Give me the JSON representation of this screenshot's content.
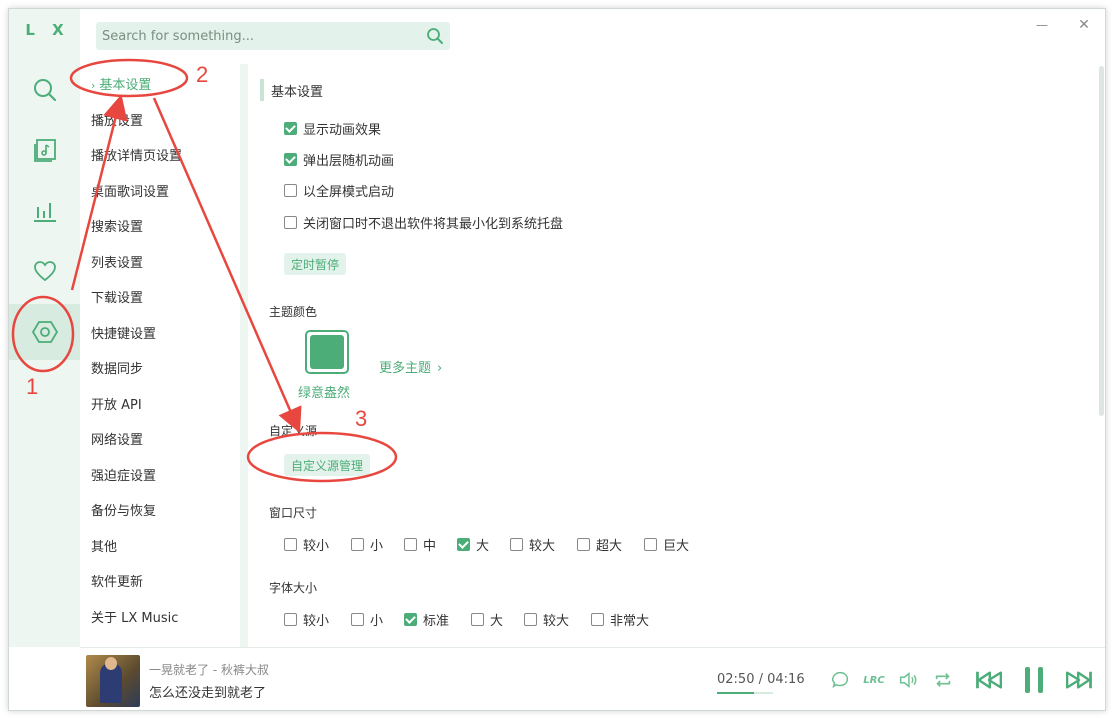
{
  "app": {
    "logo": "L X"
  },
  "search": {
    "placeholder": "Search for something..."
  },
  "window_controls": {
    "minimize": "—",
    "close": "✕"
  },
  "rail": [
    "search-icon",
    "song-list-icon",
    "leaderboard-icon",
    "heart-icon",
    "settings-icon"
  ],
  "sidenav": {
    "items": [
      {
        "label": "基本设置",
        "active": true
      },
      {
        "label": "播放设置"
      },
      {
        "label": "播放详情页设置"
      },
      {
        "label": "桌面歌词设置"
      },
      {
        "label": "搜索设置"
      },
      {
        "label": "列表设置"
      },
      {
        "label": "下载设置"
      },
      {
        "label": "快捷键设置"
      },
      {
        "label": "数据同步"
      },
      {
        "label": "开放 API"
      },
      {
        "label": "网络设置"
      },
      {
        "label": "强迫症设置"
      },
      {
        "label": "备份与恢复"
      },
      {
        "label": "其他"
      },
      {
        "label": "软件更新"
      },
      {
        "label": "关于 LX Music"
      }
    ]
  },
  "content": {
    "section_title": "基本设置",
    "options": [
      {
        "label": "显示动画效果",
        "checked": true
      },
      {
        "label": "弹出层随机动画",
        "checked": true
      },
      {
        "label": "以全屏模式启动",
        "checked": false
      },
      {
        "label": "关闭窗口时不退出软件将其最小化到系统托盘",
        "checked": false
      }
    ],
    "timer_button": "定时暂停",
    "theme": {
      "heading": "主题颜色",
      "current": "绿意盎然",
      "more": "更多主题",
      "color": "#4cad78"
    },
    "custom_source": {
      "heading": "自定义源",
      "button": "自定义源管理"
    },
    "window_size": {
      "heading": "窗口尺寸",
      "options": [
        {
          "label": "较小",
          "checked": false
        },
        {
          "label": "小",
          "checked": false
        },
        {
          "label": "中",
          "checked": false
        },
        {
          "label": "大",
          "checked": true
        },
        {
          "label": "较大",
          "checked": false
        },
        {
          "label": "超大",
          "checked": false
        },
        {
          "label": "巨大",
          "checked": false
        }
      ]
    },
    "font_size": {
      "heading": "字体大小",
      "options": [
        {
          "label": "较小",
          "checked": false
        },
        {
          "label": "小",
          "checked": false
        },
        {
          "label": "标准",
          "checked": true
        },
        {
          "label": "大",
          "checked": false
        },
        {
          "label": "较大",
          "checked": false
        },
        {
          "label": "非常大",
          "checked": false
        }
      ]
    }
  },
  "player": {
    "subtitle": "一晃就老了 - 秋裤大叔",
    "title": "怎么还没走到就老了",
    "current_time": "02:50",
    "total_time": "04:16",
    "time_separator": " / ",
    "progress": 0.66,
    "lyric_toggle": "LRC"
  },
  "annotations": {
    "n1": "1",
    "n2": "2",
    "n3": "3",
    "color": "#e8473f"
  },
  "colors": {
    "accent": "#4cad78",
    "accent_light": "#e3f2ea",
    "rail_bg": "#edf6f1"
  }
}
